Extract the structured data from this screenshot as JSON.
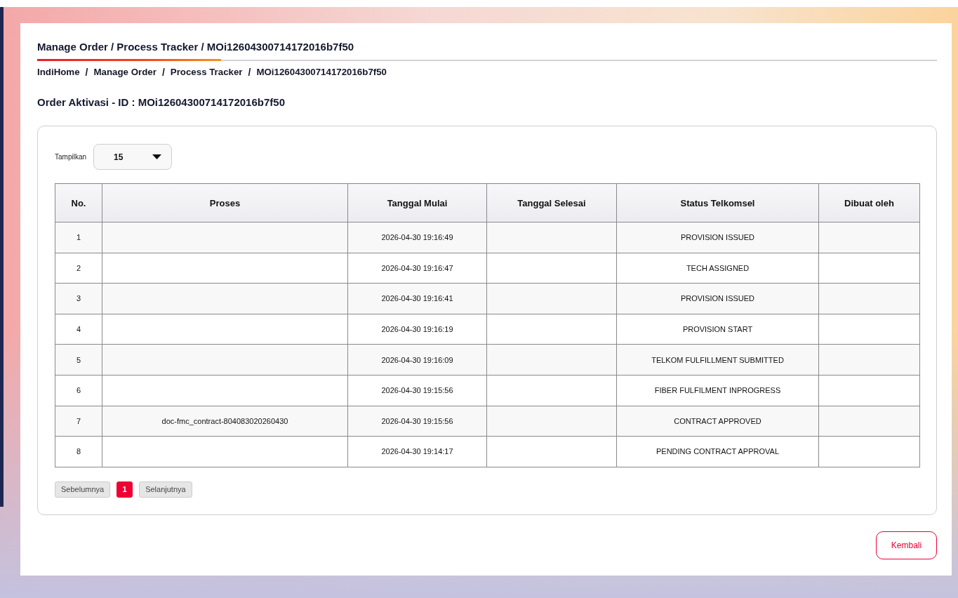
{
  "page_title": "Manage Order / Process Tracker / MOi12604300714172016b7f50",
  "breadcrumb": [
    {
      "label": "IndiHome"
    },
    {
      "separator": "/",
      "label": "Manage Order"
    },
    {
      "separator": "/",
      "label": "Process Tracker"
    },
    {
      "separator": "/",
      "label": "MOi12604300714172016b7f50"
    }
  ],
  "heading": "Order Aktivasi - ID : MOi12604300714172016b7f50",
  "page_size": {
    "label": "Tampilkan",
    "value": "15"
  },
  "table": {
    "columns": [
      "No.",
      "Proses",
      "Tanggal Mulai",
      "Tanggal Selesai",
      "Status Telkomsel",
      "Dibuat oleh"
    ],
    "rows": [
      {
        "no": "1",
        "tanggal_mulai": "2026-04-30 19:16:49",
        "status_telkomsel": "PROVISION ISSUED"
      },
      {
        "no": "2",
        "tanggal_mulai": "2026-04-30 19:16:47",
        "status_telkomsel": "TECH ASSIGNED"
      },
      {
        "no": "3",
        "tanggal_mulai": "2026-04-30 19:16:41",
        "status_telkomsel": "PROVISION ISSUED"
      },
      {
        "no": "4",
        "tanggal_mulai": "2026-04-30 19:16:19",
        "status_telkomsel": "PROVISION START"
      },
      {
        "no": "5",
        "tanggal_mulai": "2026-04-30 19:16:09",
        "status_telkomsel": "TELKOM FULFILLMENT SUBMITTED"
      },
      {
        "no": "6",
        "tanggal_mulai": "2026-04-30 19:15:56",
        "status_telkomsel": "FIBER FULFILMENT INPROGRESS"
      },
      {
        "no": "7",
        "proses": "doc-fmc_contract-804083020260430",
        "tanggal_mulai": "2026-04-30 19:15:56",
        "status_telkomsel": "CONTRACT APPROVED"
      },
      {
        "no": "8",
        "tanggal_mulai": "2026-04-30 19:14:17",
        "status_telkomsel": "PENDING CONTRACT APPROVAL"
      }
    ]
  },
  "pagination": {
    "previous": "Sebelumnya",
    "pages": [
      {
        "label": "1",
        "selected": true
      }
    ],
    "next": "Selanjutnya"
  },
  "back_button": "Kembali"
}
